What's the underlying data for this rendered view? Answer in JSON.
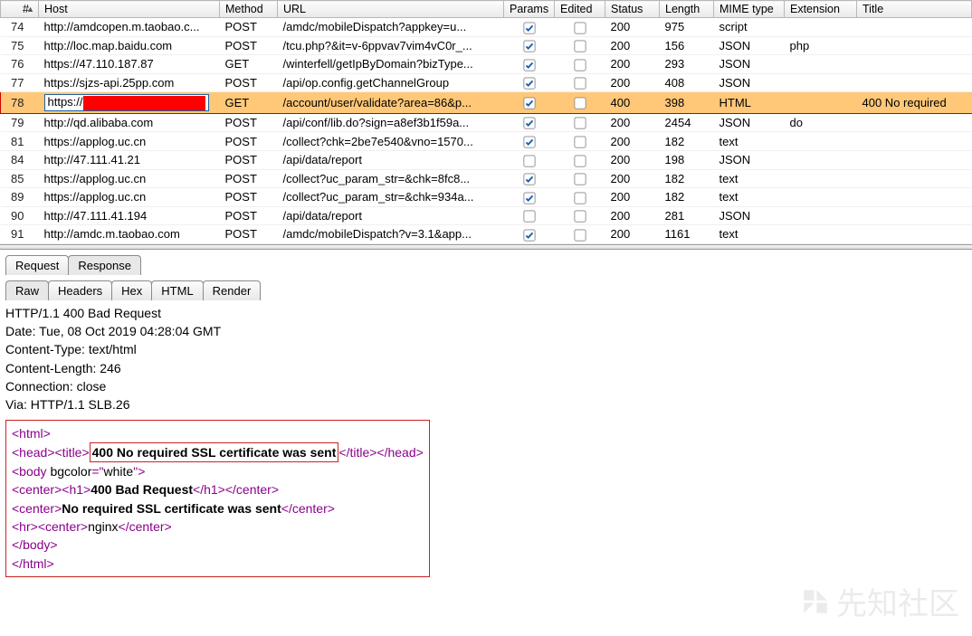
{
  "columns": {
    "num": "#",
    "host": "Host",
    "method": "Method",
    "url": "URL",
    "params": "Params",
    "edited": "Edited",
    "status": "Status",
    "length": "Length",
    "mime": "MIME type",
    "extension": "Extension",
    "title": "Title"
  },
  "sort_indicator": "▲",
  "rows": [
    {
      "n": "74",
      "host": "http://amdcopen.m.taobao.c...",
      "method": "POST",
      "url": "/amdc/mobileDispatch?appkey=u...",
      "params": true,
      "edited": false,
      "status": "200",
      "length": "975",
      "mime": "script",
      "ext": "",
      "title": ""
    },
    {
      "n": "75",
      "host": "http://loc.map.baidu.com",
      "method": "POST",
      "url": "/tcu.php?&it=v-6ppvav7vim4vC0r_...",
      "params": true,
      "edited": false,
      "status": "200",
      "length": "156",
      "mime": "JSON",
      "ext": "php",
      "title": ""
    },
    {
      "n": "76",
      "host": "https://47.110.187.87",
      "method": "GET",
      "url": "/winterfell/getIpByDomain?bizType...",
      "params": true,
      "edited": false,
      "status": "200",
      "length": "293",
      "mime": "JSON",
      "ext": "",
      "title": ""
    },
    {
      "n": "77",
      "host": "https://sjzs-api.25pp.com",
      "method": "POST",
      "url": "/api/op.config.getChannelGroup",
      "params": true,
      "edited": false,
      "status": "200",
      "length": "408",
      "mime": "JSON",
      "ext": "",
      "title": ""
    },
    {
      "n": "78",
      "host_prefix": "https://",
      "host_redacted": true,
      "method": "GET",
      "url": "/account/user/validate?area=86&p...",
      "params": true,
      "edited": false,
      "status": "400",
      "length": "398",
      "mime": "HTML",
      "ext": "",
      "title": "400 No required",
      "highlight": true
    },
    {
      "n": "79",
      "host": "http://qd.alibaba.com",
      "method": "POST",
      "url": "/api/conf/lib.do?sign=a8ef3b1f59a...",
      "params": true,
      "edited": false,
      "status": "200",
      "length": "2454",
      "mime": "JSON",
      "ext": "do",
      "title": ""
    },
    {
      "n": "81",
      "host": "https://applog.uc.cn",
      "method": "POST",
      "url": "/collect?chk=2be7e540&vno=1570...",
      "params": true,
      "edited": false,
      "status": "200",
      "length": "182",
      "mime": "text",
      "ext": "",
      "title": ""
    },
    {
      "n": "84",
      "host": "http://47.111.41.21",
      "method": "POST",
      "url": "/api/data/report",
      "params": false,
      "edited": false,
      "status": "200",
      "length": "198",
      "mime": "JSON",
      "ext": "",
      "title": ""
    },
    {
      "n": "85",
      "host": "https://applog.uc.cn",
      "method": "POST",
      "url": "/collect?uc_param_str=&chk=8fc8...",
      "params": true,
      "edited": false,
      "status": "200",
      "length": "182",
      "mime": "text",
      "ext": "",
      "title": ""
    },
    {
      "n": "89",
      "host": "https://applog.uc.cn",
      "method": "POST",
      "url": "/collect?uc_param_str=&chk=934a...",
      "params": true,
      "edited": false,
      "status": "200",
      "length": "182",
      "mime": "text",
      "ext": "",
      "title": ""
    },
    {
      "n": "90",
      "host": "http://47.111.41.194",
      "method": "POST",
      "url": "/api/data/report",
      "params": false,
      "edited": false,
      "status": "200",
      "length": "281",
      "mime": "JSON",
      "ext": "",
      "title": ""
    },
    {
      "n": "91",
      "host": "http://amdc.m.taobao.com",
      "method": "POST",
      "url": "/amdc/mobileDispatch?v=3.1&app...",
      "params": true,
      "edited": false,
      "status": "200",
      "length": "1161",
      "mime": "text",
      "ext": "",
      "title": ""
    }
  ],
  "tabs1": {
    "request": "Request",
    "response": "Response"
  },
  "tabs2": {
    "raw": "Raw",
    "headers": "Headers",
    "hex": "Hex",
    "html": "HTML",
    "render": "Render"
  },
  "headers": {
    "l1": "HTTP/1.1 400 Bad Request",
    "l2": "Date: Tue, 08 Oct 2019 04:28:04 GMT",
    "l3": "Content-Type: text/html",
    "l4": "Content-Length: 246",
    "l5": "Connection: close",
    "l6": "Via: HTTP/1.1 SLB.26"
  },
  "body": {
    "t_html_o": "<html>",
    "t_head_o": "<head>",
    "t_title_o": "<title>",
    "title_text": "400 No required SSL certificate was sent",
    "t_title_c": "</title>",
    "t_head_c": "</head>",
    "t_body_o_a": "<body ",
    "attr_bg": "bgcolor",
    "eq": "=",
    "q": "\"",
    "val_white": "white",
    "gt": ">",
    "t_center_o": "<center>",
    "t_h1_o": "<h1>",
    "bad_req": "400 Bad Request",
    "t_h1_c": "</h1>",
    "t_center_c": "</center>",
    "no_cert": "No required SSL certificate was sent",
    "t_hr": "<hr>",
    "nginx": "nginx",
    "t_body_c": "</body>",
    "t_html_c": "</html>"
  },
  "watermark": "先知社区"
}
